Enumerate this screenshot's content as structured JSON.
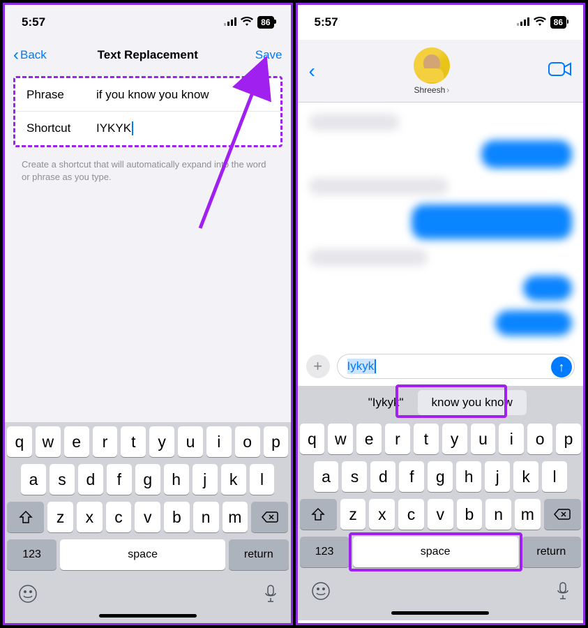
{
  "status": {
    "time": "5:57",
    "battery": "86"
  },
  "left": {
    "nav": {
      "back": "Back",
      "title": "Text Replacement",
      "save": "Save"
    },
    "form": {
      "phrase_label": "Phrase",
      "phrase_value": "if you know you know",
      "shortcut_label": "Shortcut",
      "shortcut_value": "IYKYK"
    },
    "hint": "Create a shortcut that will automatically expand into the word or phrase as you type."
  },
  "right": {
    "contact": "Shreesh",
    "input_text": "Iykyk",
    "suggestions": {
      "first": "\"Iykyk\"",
      "second": "know you know"
    }
  },
  "keyboard": {
    "row1": [
      "q",
      "w",
      "e",
      "r",
      "t",
      "y",
      "u",
      "i",
      "o",
      "p"
    ],
    "row2": [
      "a",
      "s",
      "d",
      "f",
      "g",
      "h",
      "j",
      "k",
      "l"
    ],
    "row3": [
      "z",
      "x",
      "c",
      "v",
      "b",
      "n",
      "m"
    ],
    "num": "123",
    "space": "space",
    "ret": "return"
  }
}
